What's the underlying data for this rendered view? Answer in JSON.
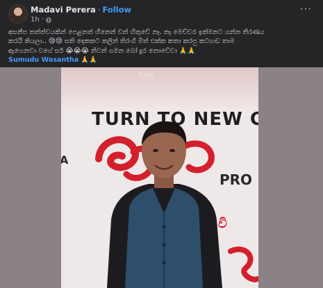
{
  "post": {
    "author": "Madavi Perera",
    "separator": "·",
    "follow_label": "Follow",
    "time": "1h",
    "more_label": "···",
    "caption_line1": "අසනීප තත්ත්වයකින් පෙළනත් හීනෙන් වත් හිතුවේ නෑ. නෑ මෙච්චර ඉක්මනට යන්න තීරණය",
    "caption_line2": "කරයි කියලා.. 😢😢 සති දෙකකට කලින් තිරංගි මීත් එක්ක කතා කරපු කටහඬ තාම",
    "caption_line3": "ඇහෙනවා වගේ සර් 😭😭😭 නිවන් ගමන බෝ දුර නොවේවා 🙏🙏",
    "mention": "Sumudu Wasantha",
    "mention_suffix": " 🙏🙏"
  },
  "photo": {
    "banner_title": "TURN TO NEW C",
    "banner_pro": "PRO",
    "banner_a": "A",
    "banner_sinhala_top": "විශාල",
    "banner_sinhala_right": "වි",
    "banner_sinhala_bottom": "ජී"
  },
  "colors": {
    "card_bg": "#242526",
    "link": "#4599ff",
    "banner_red": "#d3202c",
    "vest": "#2e4f6b"
  },
  "icons": {
    "globe": "globe-icon",
    "more": "more-options-icon"
  }
}
